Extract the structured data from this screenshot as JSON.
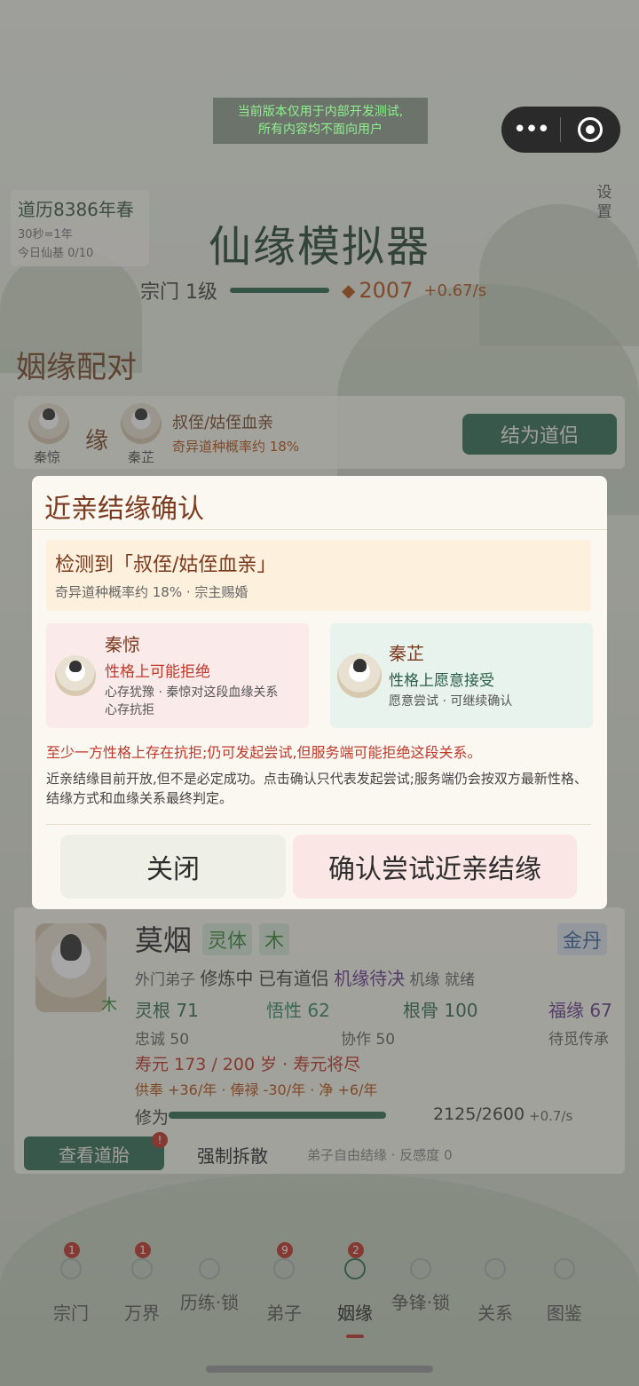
{
  "notice": {
    "line1": "当前版本仅用于内部开发测试,",
    "line2": "所有内容均不面向用户"
  },
  "header": {
    "calendar_year": "道历8386年春",
    "time_scale": "30秒=1年",
    "daily": "今日仙基 0/10",
    "settings": "设置",
    "title": "仙缘模拟器",
    "sect_level": "宗门 1级",
    "gold": "2007",
    "gold_rate": "+0.67/s"
  },
  "matching": {
    "heading": "姻缘配对",
    "person_a": "秦惊",
    "yuan": "缘",
    "person_b": "秦芷",
    "relation": "叔侄/姑侄血亲",
    "probability": "奇异道种概率约 18%",
    "bond_button": "结为道侣"
  },
  "modal": {
    "title": "近亲结缘确认",
    "detect_title": "检测到「叔侄/姑侄血亲」",
    "detect_sub": "奇异道种概率约 18% · 宗主赐婚",
    "left": {
      "name": "秦惊",
      "attitude": "性格上可能拒绝",
      "desc1": "心存犹豫 · 秦惊对这段血缘关系",
      "desc2": "心存抗拒"
    },
    "right": {
      "name": "秦芷",
      "attitude": "性格上愿意接受",
      "desc1": "愿意尝试 · 可继续确认"
    },
    "warning": "至少一方性格上存在抗拒;仍可发起尝试,但服务端可能拒绝这段关系。",
    "note": "近亲结缘目前开放,但不是必定成功。点击确认只代表发起尝试;服务端仍会按双方最新性格、结缘方式和血缘关系最终判定。",
    "close": "关闭",
    "confirm": "确认尝试近亲结缘"
  },
  "disciple": {
    "name": "莫烟",
    "tag1": "灵体",
    "tag2": "木",
    "realm": "金丹",
    "element": "木",
    "rank": "外门弟子",
    "status1": "修炼中",
    "status2": "已有道侣",
    "status3": "机缘待决",
    "status4": "机缘",
    "status5": "就绪",
    "linggen": "灵根 71",
    "wuxing": "悟性 62",
    "gengu": "根骨 100",
    "fuyuan": "福缘 67",
    "loyalty": "忠诚 50",
    "coop": "协作 50",
    "inherit": "待觅传承",
    "lifespan": "寿元 173 / 200 岁 · 寿元将尽",
    "economy": "供奉 +36/年 · 俸禄 -30/年 · 净 +6/年",
    "cultivation_label": "修为",
    "cultivation_progress": 0.817,
    "cultivation_value": "2125/2600",
    "cultivation_rate": "+0.7/s",
    "view_button": "查看道胎",
    "view_badge": "!",
    "force_split": "强制拆散",
    "free_note": "弟子自由结缘 · 反感度 0"
  },
  "nav": [
    {
      "label": "宗门",
      "badge": "1"
    },
    {
      "label": "万界",
      "badge": "1"
    },
    {
      "label": "历练·锁",
      "badge": ""
    },
    {
      "label": "弟子",
      "badge": "9"
    },
    {
      "label": "姻缘",
      "badge": "2"
    },
    {
      "label": "争锋·锁",
      "badge": ""
    },
    {
      "label": "关系",
      "badge": ""
    },
    {
      "label": "图鉴",
      "badge": ""
    }
  ],
  "colors": {
    "accent": "#356f58",
    "warning": "#c0392b",
    "title_brown": "#7b3a1e"
  }
}
